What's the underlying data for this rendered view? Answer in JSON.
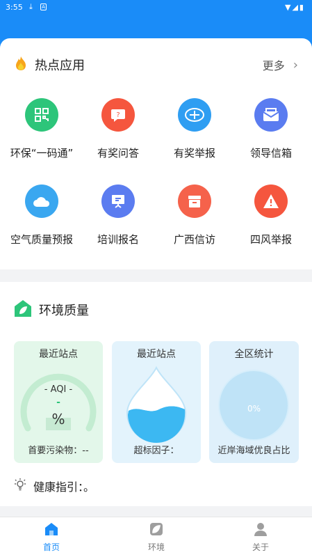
{
  "status_bar": {
    "time": "3:55"
  },
  "hot_apps": {
    "title": "热点应用",
    "more_label": "更多",
    "items": [
      {
        "label": "环保“一码通”",
        "icon": "qr-code-icon",
        "color": "#2dc57a"
      },
      {
        "label": "有奖问答",
        "icon": "question-chat-icon",
        "color": "#f5563e"
      },
      {
        "label": "有奖举报",
        "icon": "report-badge-icon",
        "color": "#2f9ef2"
      },
      {
        "label": "领导信箱",
        "icon": "mailbox-icon",
        "color": "#5a7cf0"
      },
      {
        "label": "空气质量预报",
        "icon": "cloud-icon",
        "color": "#3aa7f0"
      },
      {
        "label": "培训报名",
        "icon": "presentation-board-icon",
        "color": "#5b7cf0"
      },
      {
        "label": "广西信访",
        "icon": "archive-box-icon",
        "color": "#f5624b"
      },
      {
        "label": "四风举报",
        "icon": "warning-triangle-icon",
        "color": "#f5563e"
      }
    ]
  },
  "environment": {
    "title": "环境质量",
    "panels": [
      {
        "title": "最近站点",
        "aqi_label": "- AQI -",
        "aqi_value": "-",
        "unit": "%",
        "footer": "首要污染物：--"
      },
      {
        "title": "最近站点",
        "footer": "超标因子："
      },
      {
        "title": "全区统计",
        "percent": "0%",
        "footer": "近岸海域优良占比"
      }
    ],
    "health_label": "健康指引：。"
  },
  "tabs": [
    {
      "label": "首页",
      "active": true
    },
    {
      "label": "环境",
      "active": false
    },
    {
      "label": "关于",
      "active": false
    }
  ],
  "colors": {
    "primary": "#1a8cf8",
    "green": "#2dc57a"
  }
}
